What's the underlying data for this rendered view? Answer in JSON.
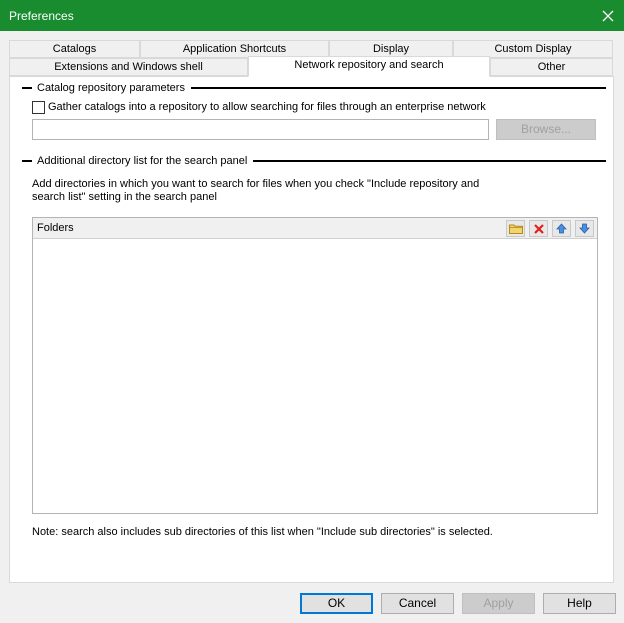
{
  "window": {
    "title": "Preferences"
  },
  "tabs_row1": [
    "Catalogs",
    "Application Shortcuts",
    "Display",
    "Custom Display"
  ],
  "tabs_row2": [
    "Extensions and Windows shell",
    "Network repository and search",
    "Other"
  ],
  "catalog_repo": {
    "heading": "Catalog repository parameters",
    "checkbox_label": "Gather catalogs into a repository to allow searching for files through an enterprise network",
    "checked": false,
    "path_value": "",
    "browse_label": "Browse..."
  },
  "directories": {
    "heading": "Additional directory list for the search panel",
    "description_line1": "Add directories in which you want to search for files when you check \"Include repository and",
    "description_line2": "search list\" setting in the search panel",
    "list_header": "Folders",
    "toolbar_icons": [
      "add-folder-icon",
      "delete-icon",
      "move-up-icon",
      "move-down-icon"
    ],
    "folders": [],
    "note": "Note: search also includes sub directories of this list when \"Include sub directories\" is selected."
  },
  "buttons": {
    "ok": "OK",
    "cancel": "Cancel",
    "apply": "Apply",
    "help": "Help"
  },
  "colors": {
    "titlebar": "#188c2f",
    "accent": "#0078d7"
  }
}
